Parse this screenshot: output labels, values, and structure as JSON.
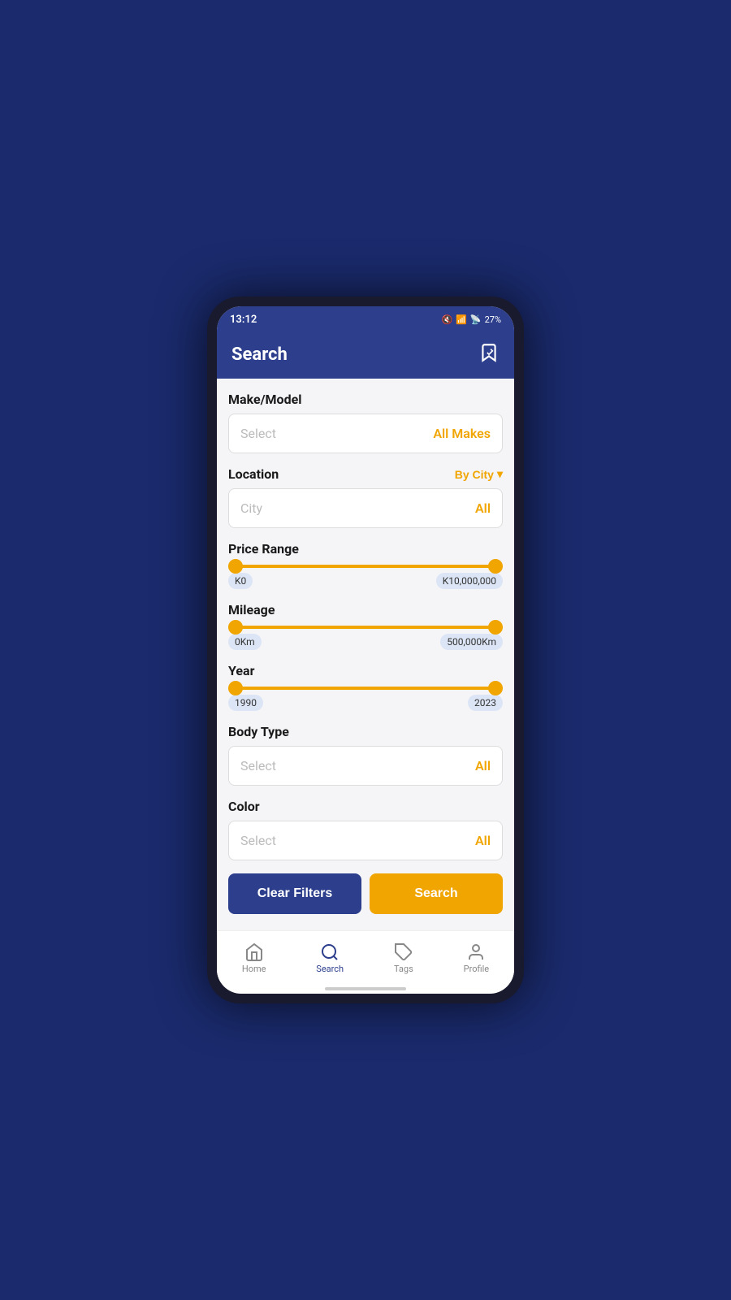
{
  "statusBar": {
    "time": "13:12",
    "battery": "27%"
  },
  "header": {
    "title": "Search",
    "iconLabel": "bookmark-edit-icon"
  },
  "makeModel": {
    "label": "Make/Model",
    "placeholder": "Select",
    "value": "All Makes"
  },
  "location": {
    "label": "Location",
    "byCity": "By City",
    "placeholder": "City",
    "value": "All"
  },
  "priceRange": {
    "label": "Price Range",
    "minValue": "K0",
    "maxValue": "K10,000,000"
  },
  "mileage": {
    "label": "Mileage",
    "minValue": "0Km",
    "maxValue": "500,000Km"
  },
  "year": {
    "label": "Year",
    "minValue": "1990",
    "maxValue": "2023"
  },
  "bodyType": {
    "label": "Body Type",
    "placeholder": "Select",
    "value": "All"
  },
  "color": {
    "label": "Color",
    "placeholder": "Select",
    "value": "All"
  },
  "buttons": {
    "clearFilters": "Clear Filters",
    "search": "Search"
  },
  "bottomNav": {
    "items": [
      {
        "label": "Home",
        "icon": "home-icon",
        "active": false
      },
      {
        "label": "Search",
        "icon": "search-icon",
        "active": true
      },
      {
        "label": "Tags",
        "icon": "tag-icon",
        "active": false
      },
      {
        "label": "Profile",
        "icon": "profile-icon",
        "active": false
      }
    ]
  }
}
